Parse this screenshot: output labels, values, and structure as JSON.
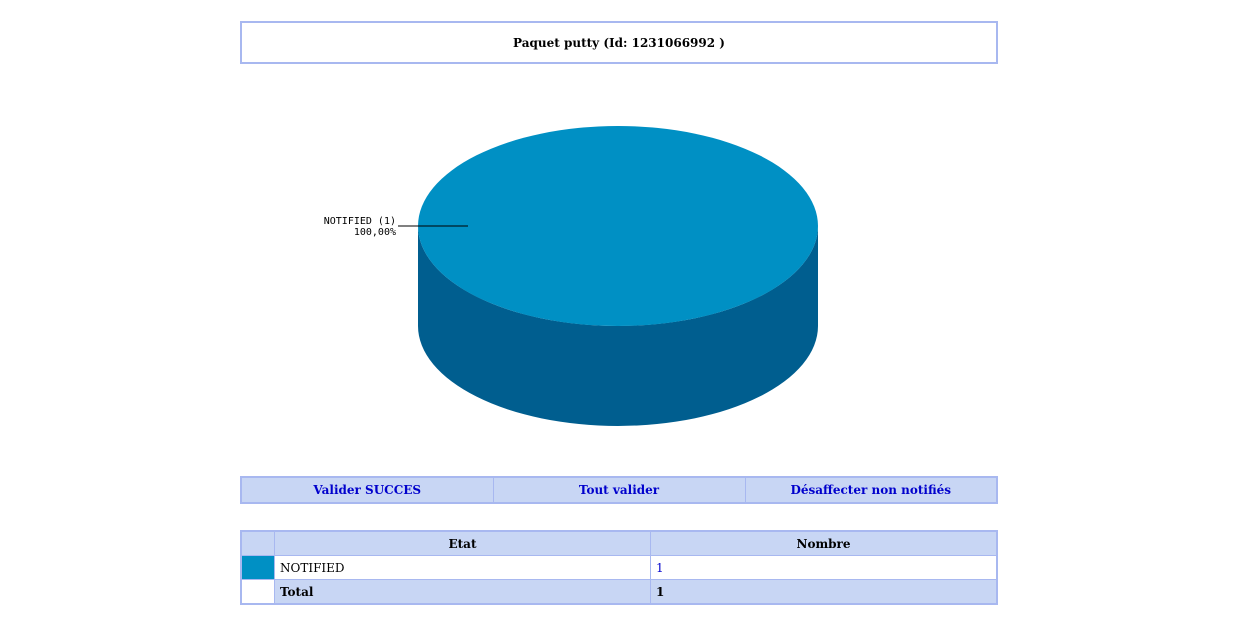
{
  "page": {
    "title": "Paquet putty (Id: 1231066992 )"
  },
  "chart_data": {
    "type": "pie",
    "slices": [
      {
        "label": "NOTIFIED (1)",
        "percent_label": "100,00%",
        "value": 1,
        "color_top": "#0090c4",
        "color_side": "#005e8f"
      }
    ]
  },
  "actions": [
    {
      "label": "Valider SUCCES"
    },
    {
      "label": "Tout valider"
    },
    {
      "label": "Désaffecter non notifiés"
    }
  ],
  "table": {
    "headers": {
      "etat": "Etat",
      "nombre": "Nombre"
    },
    "rows": [
      {
        "color": "#0090c4",
        "etat": "NOTIFIED",
        "nombre": "1"
      }
    ],
    "total": {
      "label": "Total",
      "value": "1"
    }
  }
}
